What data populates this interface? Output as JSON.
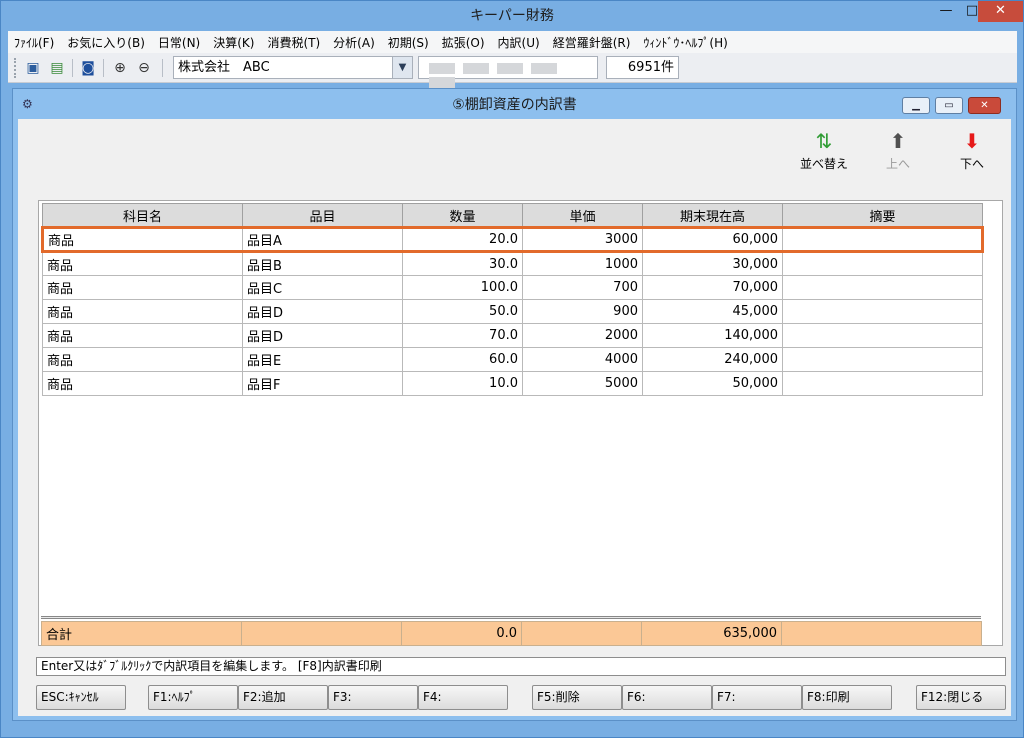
{
  "app": {
    "title": "キーパー財務"
  },
  "menu": [
    "ﾌｧｲﾙ(F)",
    "お気に入り(B)",
    "日常(N)",
    "決算(K)",
    "消費税(T)",
    "分析(A)",
    "初期(S)",
    "拡張(O)",
    "内訳(U)",
    "経営羅針盤(R)",
    "ｳｨﾝﾄﾞｳ･ﾍﾙﾌﾟ(H)"
  ],
  "toolbar": {
    "company": "株式会社　ABC",
    "count": "6951件"
  },
  "window": {
    "title": "⑤棚卸資産の内訳書"
  },
  "actions": {
    "sort": "並べ替え",
    "up": "上へ",
    "down": "下へ"
  },
  "table": {
    "headers": [
      "科目名",
      "品目",
      "数量",
      "単価",
      "期末現在高",
      "摘要"
    ],
    "rows": [
      [
        "商品",
        "品目A",
        "20.0",
        "3000",
        "60,000",
        ""
      ],
      [
        "商品",
        "品目B",
        "30.0",
        "1000",
        "30,000",
        ""
      ],
      [
        "商品",
        "品目C",
        "100.0",
        "700",
        "70,000",
        ""
      ],
      [
        "商品",
        "品目D",
        "50.0",
        "900",
        "45,000",
        ""
      ],
      [
        "商品",
        "品目D",
        "70.0",
        "2000",
        "140,000",
        ""
      ],
      [
        "商品",
        "品目E",
        "60.0",
        "4000",
        "240,000",
        ""
      ],
      [
        "商品",
        "品目F",
        "10.0",
        "5000",
        "50,000",
        ""
      ]
    ],
    "total": [
      "合計",
      "",
      "0.0",
      "",
      "635,000",
      ""
    ]
  },
  "status": "Enter又はﾀﾞﾌﾞﾙｸﾘｯｸで内訳項目を編集します。 [F8]内訳書印刷",
  "fkeys": [
    "ESC:ｷｬﾝｾﾙ",
    "F1:ﾍﾙﾌﾟ",
    "F2:追加",
    "F3:",
    "F4:",
    "F5:削除",
    "F6:",
    "F7:",
    "F8:印刷",
    "F12:閉じる"
  ],
  "colors": {
    "selection": "#e26a2b",
    "total_row": "#fbc896",
    "title_bar": "#78aee3"
  }
}
